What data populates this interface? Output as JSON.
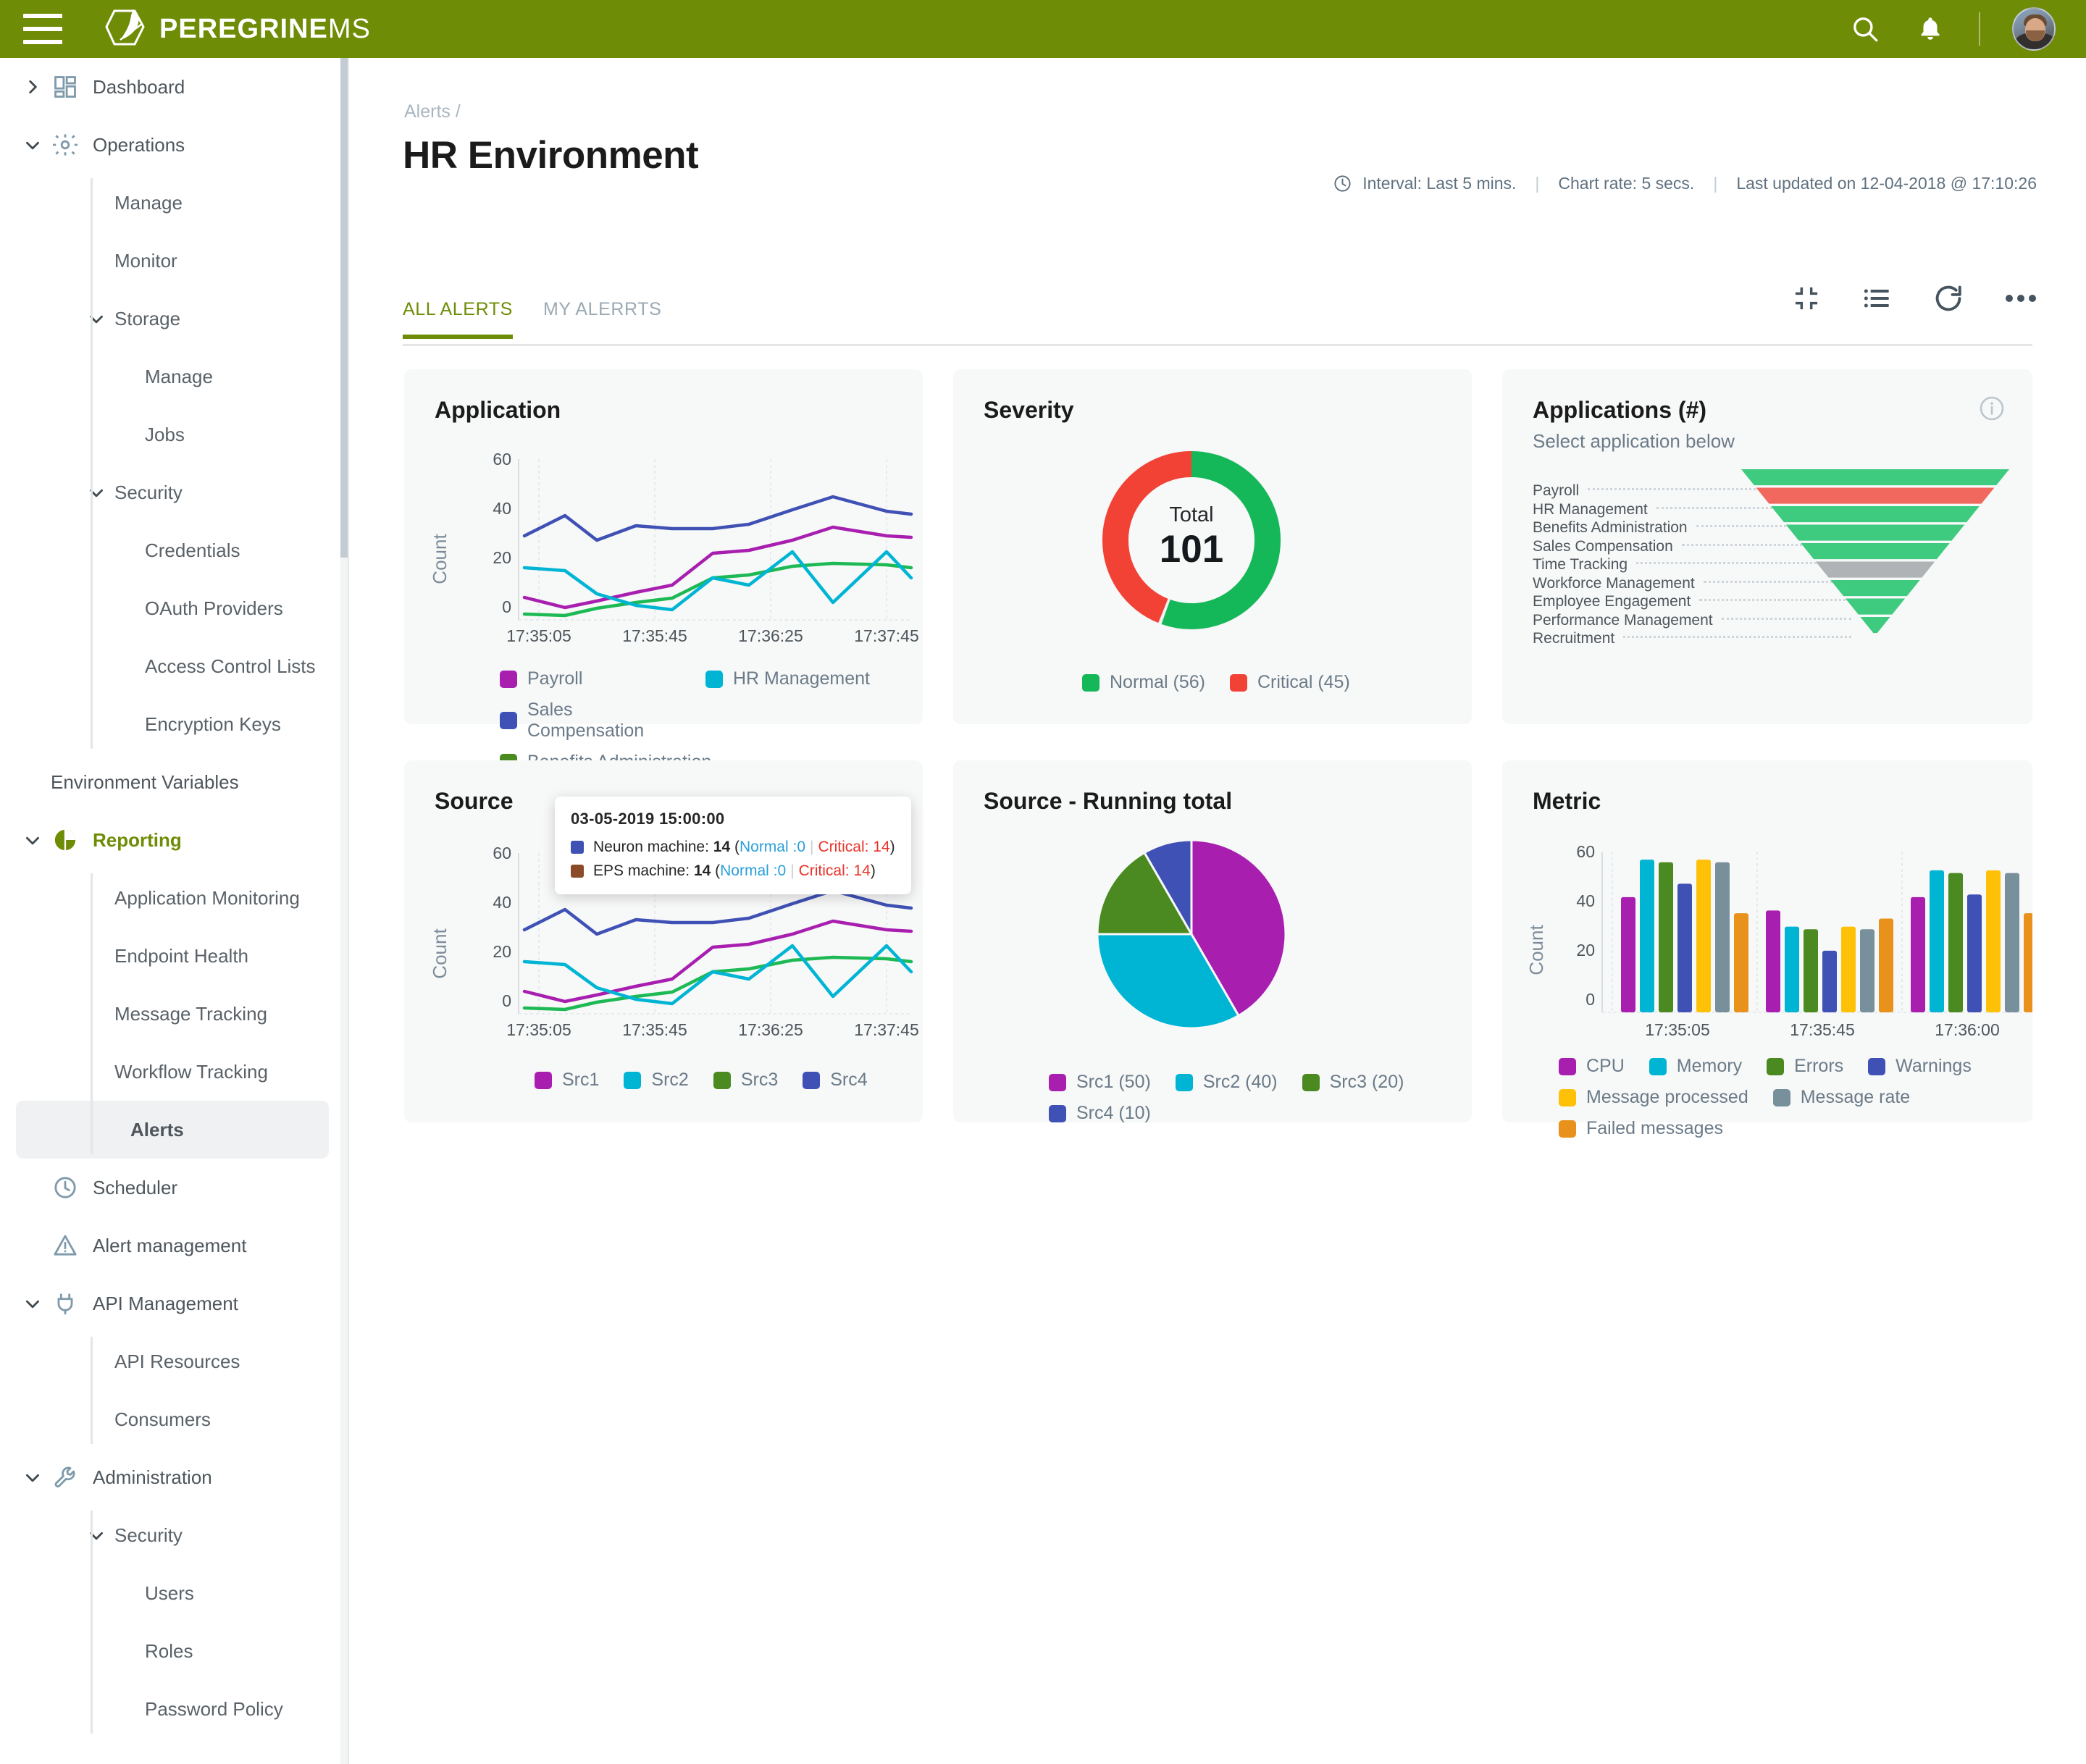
{
  "topbar": {
    "menu_icon": "hamburger-icon",
    "logo_bold": "PEREGRINE",
    "logo_light": "MS",
    "search_icon": "search-icon",
    "bell_icon": "notification-bell-icon",
    "avatar": "user-avatar"
  },
  "sidebar": {
    "items": [
      {
        "label": "Dashboard",
        "level": 0,
        "caret": "right",
        "icon": "dashboard-grid-icon"
      },
      {
        "label": "Operations",
        "level": 0,
        "caret": "down",
        "icon": "gear-icon"
      },
      {
        "label": "Manage",
        "level": 1,
        "caret": "none",
        "icon": ""
      },
      {
        "label": "Monitor",
        "level": 1,
        "caret": "none",
        "icon": ""
      },
      {
        "label": "Storage",
        "level": 1,
        "caret": "down",
        "icon": ""
      },
      {
        "label": "Manage",
        "level": 2,
        "caret": "none",
        "icon": ""
      },
      {
        "label": "Jobs",
        "level": 2,
        "caret": "none",
        "icon": ""
      },
      {
        "label": "Security",
        "level": 1,
        "caret": "down",
        "icon": ""
      },
      {
        "label": "Credentials",
        "level": 2,
        "caret": "none",
        "icon": ""
      },
      {
        "label": "OAuth Providers",
        "level": 2,
        "caret": "none",
        "icon": ""
      },
      {
        "label": "Access Control Lists",
        "level": 2,
        "caret": "none",
        "icon": ""
      },
      {
        "label": "Encryption Keys",
        "level": 2,
        "caret": "none",
        "icon": ""
      },
      {
        "label": "Environment Variables",
        "level": 0,
        "caret": "none",
        "icon": ""
      },
      {
        "label": "Reporting",
        "level": 0,
        "caret": "down",
        "icon": "pie-chart-icon",
        "active_section": true
      },
      {
        "label": "Application Monitoring",
        "level": 1,
        "caret": "none",
        "icon": ""
      },
      {
        "label": "Endpoint Health",
        "level": 1,
        "caret": "none",
        "icon": ""
      },
      {
        "label": "Message Tracking",
        "level": 1,
        "caret": "none",
        "icon": ""
      },
      {
        "label": "Workflow Tracking",
        "level": 1,
        "caret": "none",
        "icon": ""
      },
      {
        "label": "Alerts",
        "level": 1,
        "caret": "none",
        "icon": "",
        "selected": true
      },
      {
        "label": "Scheduler",
        "level": 0,
        "caret": "none",
        "icon": "clock-icon"
      },
      {
        "label": "Alert management",
        "level": 0,
        "caret": "none",
        "icon": "warning-triangle-icon"
      },
      {
        "label": "API Management",
        "level": 0,
        "caret": "down",
        "icon": "plug-icon"
      },
      {
        "label": "API Resources",
        "level": 1,
        "caret": "none",
        "icon": ""
      },
      {
        "label": "Consumers",
        "level": 1,
        "caret": "none",
        "icon": ""
      },
      {
        "label": "Administration",
        "level": 0,
        "caret": "down",
        "icon": "wrench-icon"
      },
      {
        "label": "Security",
        "level": 1,
        "caret": "down",
        "icon": ""
      },
      {
        "label": "Users",
        "level": 2,
        "caret": "none",
        "icon": ""
      },
      {
        "label": "Roles",
        "level": 2,
        "caret": "none",
        "icon": ""
      },
      {
        "label": "Password Policy",
        "level": 2,
        "caret": "none",
        "icon": ""
      }
    ]
  },
  "page": {
    "breadcrumb": "Alerts /",
    "title": "HR Environment",
    "meta": {
      "clock_icon": "clock-icon",
      "interval": "Interval: Last 5 mins.",
      "chart_rate": "Chart rate: 5 secs.",
      "last_updated": "Last updated on 12-04-2018 @ 17:10:26",
      "separator": "|"
    },
    "tabs": [
      {
        "label": "ALL ALERTS",
        "active": true
      },
      {
        "label": "MY ALERRTS",
        "active": false
      }
    ],
    "toolbar": [
      {
        "name": "collapse-icon"
      },
      {
        "name": "list-view-icon"
      },
      {
        "name": "refresh-icon"
      },
      {
        "name": "more-options-icon"
      }
    ]
  },
  "colors": {
    "brand_green": "#6f8c06",
    "payroll": "#a81fb0",
    "hr_management": "#00b5d4",
    "sales_compensation": "#3f51b5",
    "benefits_administration": "#1db954",
    "benefits_admin_swatch": "#4a8a20",
    "normal_green": "#14b858",
    "critical_red": "#f24236",
    "funnel_green": "#3ecb7f",
    "funnel_red": "#f1685e",
    "funnel_grey": "#b0b3b5",
    "src1": "#a81fb0",
    "src2": "#00b5d4",
    "src3": "#4a8a20",
    "src4": "#3f51b5",
    "cpu": "#a81fb0",
    "memory": "#00b5d4",
    "errors": "#4a8a20",
    "warnings": "#3f51b5",
    "message_processed": "#ffc107",
    "message_rate": "#78909c",
    "failed_messages": "#e8921b",
    "tooltip_neuron": "#3f51b5",
    "tooltip_eps": "#8b4b28"
  },
  "cards": {
    "application": {
      "title": "Application"
    },
    "severity": {
      "title": "Severity"
    },
    "applications_funnel": {
      "title": "Applications (#)",
      "subtitle": "Select application below",
      "info_icon": "info-icon"
    },
    "source": {
      "title": "Source"
    },
    "source_running_total": {
      "title": "Source - Running total"
    },
    "metric": {
      "title": "Metric"
    }
  },
  "tooltip": {
    "timestamp": "03-05-2019  15:00:00",
    "rows": [
      {
        "series": "Neuron machine",
        "value": "14",
        "normal": "Normal :0",
        "critical": "Critical: 14",
        "color": "#3f51b5"
      },
      {
        "series": "EPS machine",
        "value": "14",
        "normal": "Normal :0",
        "critical": "Critical: 14",
        "color": "#8b4b28"
      }
    ],
    "open_paren": "(",
    "close_paren": ")",
    "pipe": "|"
  },
  "chart_data": [
    {
      "id": "application",
      "type": "line",
      "title": "Application",
      "xlabel": "",
      "ylabel": "Count",
      "ylim": [
        0,
        60
      ],
      "yticks": [
        0,
        20,
        40,
        60
      ],
      "xticks": [
        "17:35:05",
        "17:35:45",
        "17:36:25",
        "17:37:45"
      ],
      "grid": true,
      "legend_position": "bottom",
      "series": [
        {
          "name": "Payroll",
          "color": "#a81fb0",
          "values": [
            9,
            5,
            8,
            11,
            14,
            27,
            28,
            33,
            38,
            34
          ]
        },
        {
          "name": "HR Management",
          "color": "#00b5d4",
          "values": [
            21,
            19,
            11,
            6,
            4,
            17,
            14,
            28,
            7,
            28,
            17
          ]
        },
        {
          "name": "Sales Compensation",
          "color": "#3f51b5",
          "values": [
            34,
            40,
            32,
            38,
            37,
            37,
            39,
            45,
            50,
            45
          ]
        },
        {
          "name": "Benefits Administration",
          "color": "#1db954",
          "values": [
            3,
            2,
            5,
            6,
            8,
            17,
            18,
            22,
            23,
            23,
            21
          ]
        }
      ]
    },
    {
      "id": "severity",
      "type": "pie",
      "title": "Severity",
      "center_label": "Total",
      "center_value": "101",
      "total": 101,
      "labels": [
        "Normal (56)",
        "Critical (45)"
      ],
      "categories": [
        "Normal",
        "Critical"
      ],
      "values": [
        56,
        45
      ],
      "colors": [
        "#14b858",
        "#f24236"
      ],
      "legend_position": "bottom"
    },
    {
      "id": "applications_funnel",
      "type": "bar",
      "title": "Applications (#)",
      "subtitle": "Select application below",
      "orientation": "funnel",
      "categories": [
        "Payroll",
        "HR Management",
        "Benefits Administration",
        "Sales Compensation",
        "Time Tracking",
        "Workforce Management",
        "Employee Engagement",
        "Performance Management",
        "Recruitment"
      ],
      "values": [
        9,
        8,
        7,
        6,
        5,
        4,
        3,
        2,
        1
      ],
      "segment_colors": [
        "#3ecb7f",
        "#f1685e",
        "#3ecb7f",
        "#3ecb7f",
        "#3ecb7f",
        "#b0b3b5",
        "#3ecb7f",
        "#3ecb7f",
        "#3ecb7f"
      ]
    },
    {
      "id": "source",
      "type": "line",
      "title": "Source",
      "xlabel": "",
      "ylabel": "Count",
      "ylim": [
        0,
        60
      ],
      "yticks": [
        0,
        20,
        40,
        60
      ],
      "xticks": [
        "17:35:05",
        "17:35:45",
        "17:36:25",
        "17:37:45"
      ],
      "grid": true,
      "legend_position": "bottom",
      "series": [
        {
          "name": "Src1",
          "color": "#a81fb0",
          "values": [
            9,
            5,
            8,
            11,
            14,
            27,
            28,
            33,
            38,
            34
          ]
        },
        {
          "name": "Src2",
          "color": "#00b5d4",
          "values": [
            21,
            19,
            11,
            6,
            4,
            17,
            14,
            28,
            7,
            28,
            17
          ]
        },
        {
          "name": "Src3",
          "color": "#4a8a20",
          "values": [
            3,
            2,
            5,
            6,
            8,
            17,
            18,
            22,
            23,
            23,
            21
          ]
        },
        {
          "name": "Src4",
          "color": "#3f51b5",
          "values": [
            34,
            40,
            32,
            38,
            37,
            37,
            39,
            45,
            50,
            45
          ]
        }
      ]
    },
    {
      "id": "source_running_total",
      "type": "pie",
      "title": "Source - Running total",
      "categories": [
        "Src1",
        "Src2",
        "Src3",
        "Src4"
      ],
      "labels": [
        "Src1 (50)",
        "Src2 (40)",
        "Src3 (20)",
        "Src4 (10)"
      ],
      "values": [
        50,
        40,
        20,
        10
      ],
      "colors": [
        "#a81fb0",
        "#00b5d4",
        "#4a8a20",
        "#3f51b5"
      ],
      "legend_position": "bottom"
    },
    {
      "id": "metric",
      "type": "bar",
      "title": "Metric",
      "xlabel": "",
      "ylabel": "Count",
      "ylim": [
        0,
        60
      ],
      "yticks": [
        0,
        20,
        40,
        60
      ],
      "categories": [
        "17:35:05",
        "17:35:45",
        "17:36:00"
      ],
      "grid": true,
      "legend_position": "bottom",
      "series": [
        {
          "name": "CPU",
          "color": "#a81fb0",
          "values": [
            43,
            38,
            43
          ]
        },
        {
          "name": "Memory",
          "color": "#00b5d4",
          "values": [
            57,
            32,
            53
          ]
        },
        {
          "name": "Errors",
          "color": "#4a8a20",
          "values": [
            56,
            31,
            52
          ]
        },
        {
          "name": "Warnings",
          "color": "#3f51b5",
          "values": [
            48,
            23,
            44
          ]
        },
        {
          "name": "Message processed",
          "color": "#ffc107",
          "values": [
            57,
            32,
            53
          ]
        },
        {
          "name": "Message rate",
          "color": "#78909c",
          "values": [
            56,
            31,
            52
          ]
        },
        {
          "name": "Failed messages",
          "color": "#e8921b",
          "values": [
            37,
            35,
            37
          ]
        }
      ]
    }
  ]
}
